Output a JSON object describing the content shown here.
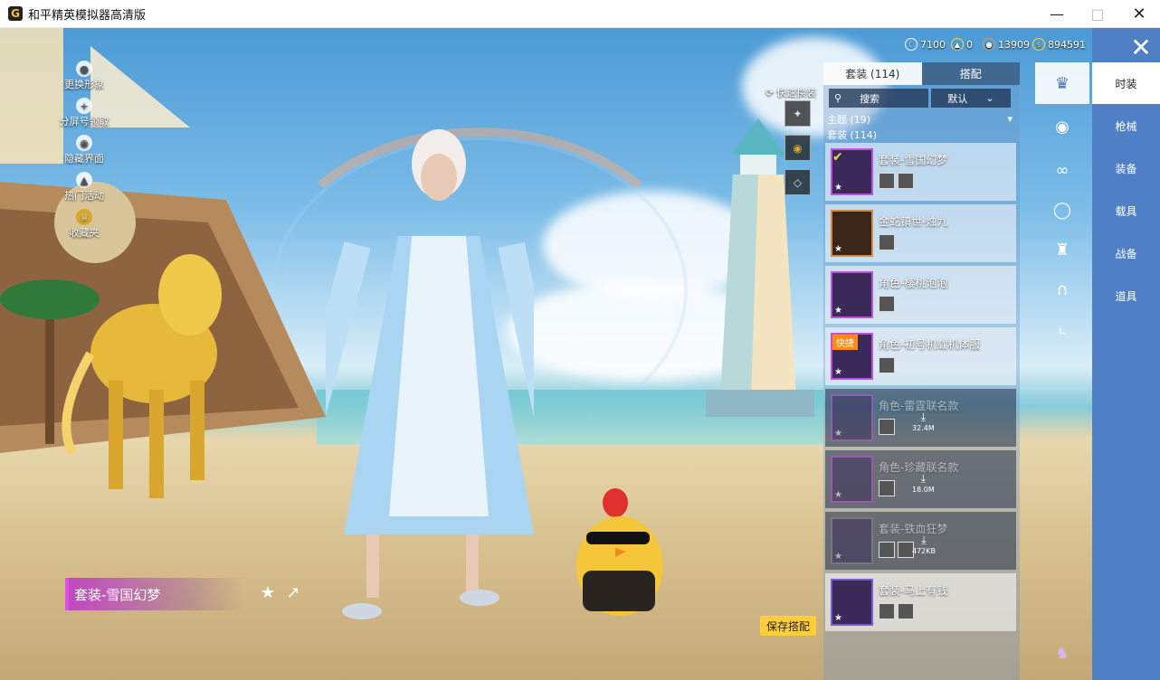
{
  "window": {
    "title": "和平精英模拟器高清版",
    "icon_letter": "G"
  },
  "currencies": [
    {
      "icon": "moon-coin-icon",
      "value": "7100"
    },
    {
      "icon": "gold-badge-icon",
      "value": "0"
    },
    {
      "icon": "bronze-coin-icon",
      "value": "13909"
    },
    {
      "icon": "gold-coin-icon",
      "value": "894591"
    }
  ],
  "left_menu": [
    {
      "label": "更换形象",
      "icon": "user-icon"
    },
    {
      "label": "分屏号领取",
      "icon": "plus-icon"
    },
    {
      "label": "隐藏界面",
      "icon": "eye-icon"
    },
    {
      "label": "热门活动",
      "icon": "fire-icon"
    },
    {
      "label": "收藏夹",
      "icon": "crown-icon"
    }
  ],
  "character": {
    "outfit_name": "套装-雪国幻梦"
  },
  "quick_swap": {
    "label": "快速换装"
  },
  "save_button": "保存搭配",
  "panel": {
    "tabs": [
      {
        "label": "套装 (114)",
        "active": true
      },
      {
        "label": "搭配",
        "active": false
      }
    ],
    "search_label": "搜索",
    "sort_label": "默认",
    "groups": [
      {
        "label": "主题 (19)"
      },
      {
        "label": "套装 (114)"
      }
    ],
    "items": [
      {
        "name": "套装-雪国幻梦",
        "checked": true,
        "dim": false
      },
      {
        "name": "金蛇镇世-烛九",
        "checked": false,
        "dim": false
      },
      {
        "name": "角色-樱桃泡泡",
        "checked": false,
        "dim": false
      },
      {
        "name": "角色-初号机载机体服",
        "badge": "快捷",
        "dim": false
      },
      {
        "name": "角色-雷霆联名款",
        "download": "32.4M",
        "dim": true
      },
      {
        "name": "角色-珍藏联名款",
        "download": "18.0M",
        "dim": true
      },
      {
        "name": "套装-铁血狂梦",
        "download": "472KB",
        "dim": true
      },
      {
        "name": "套装-马上有钱",
        "dim": false
      }
    ]
  },
  "categories": [
    {
      "icon": "outfit-icon",
      "active": true
    },
    {
      "icon": "hat-icon"
    },
    {
      "icon": "glasses-icon"
    },
    {
      "icon": "mask-icon"
    },
    {
      "icon": "top-icon"
    },
    {
      "icon": "pants-icon"
    },
    {
      "icon": "shoes-icon"
    }
  ],
  "right_tabs": [
    {
      "label": "时装",
      "active": true
    },
    {
      "label": "枪械"
    },
    {
      "label": "装备"
    },
    {
      "label": "载具"
    },
    {
      "label": "战备"
    },
    {
      "label": "道具"
    }
  ],
  "colors": {
    "accent_blue": "#4f7fc4",
    "save_yellow": "#ffce3c",
    "rarity_purple": "#c24fe0"
  }
}
